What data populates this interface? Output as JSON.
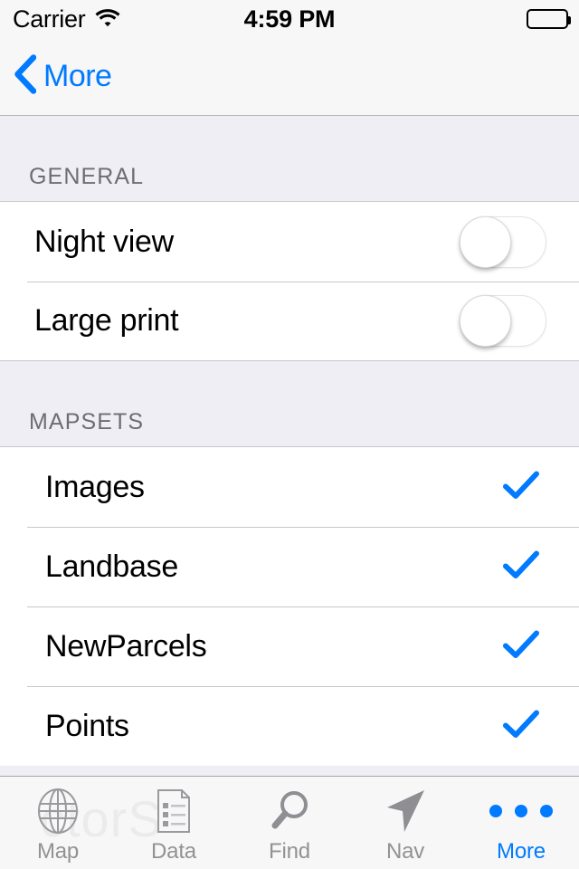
{
  "status_bar": {
    "carrier": "Carrier",
    "wifi_icon": "wifi-icon",
    "time": "4:59 PM",
    "battery_icon": "battery-full-icon"
  },
  "nav_bar": {
    "back_icon": "chevron-left-icon",
    "back_label": "More"
  },
  "sections": [
    {
      "header": "GENERAL",
      "rows": [
        {
          "label": "Night view",
          "control": "switch",
          "value": "off"
        },
        {
          "label": "Large print",
          "control": "switch",
          "value": "off"
        }
      ]
    },
    {
      "header": "MAPSETS",
      "rows": [
        {
          "label": "Images",
          "control": "checkmark",
          "value": "checked"
        },
        {
          "label": "Landbase",
          "control": "checkmark",
          "value": "checked"
        },
        {
          "label": "NewParcels",
          "control": "checkmark",
          "value": "checked"
        },
        {
          "label": "Points",
          "control": "checkmark",
          "value": "checked"
        }
      ]
    }
  ],
  "watermark": "ctorS",
  "tab_bar": {
    "items": [
      {
        "label": "Map",
        "icon": "globe-icon",
        "active": false
      },
      {
        "label": "Data",
        "icon": "document-list-icon",
        "active": false
      },
      {
        "label": "Find",
        "icon": "magnifier-icon",
        "active": false
      },
      {
        "label": "Nav",
        "icon": "navigation-arrow-icon",
        "active": false
      },
      {
        "label": "More",
        "icon": "ellipsis-icon",
        "active": true
      }
    ]
  },
  "colors": {
    "accent": "#007AFF",
    "group_background": "#EFEEF4",
    "bar_background": "#F7F7F8",
    "separator": "#C8C7CC",
    "header_text": "#6D6D72",
    "tab_inactive": "#929292"
  }
}
